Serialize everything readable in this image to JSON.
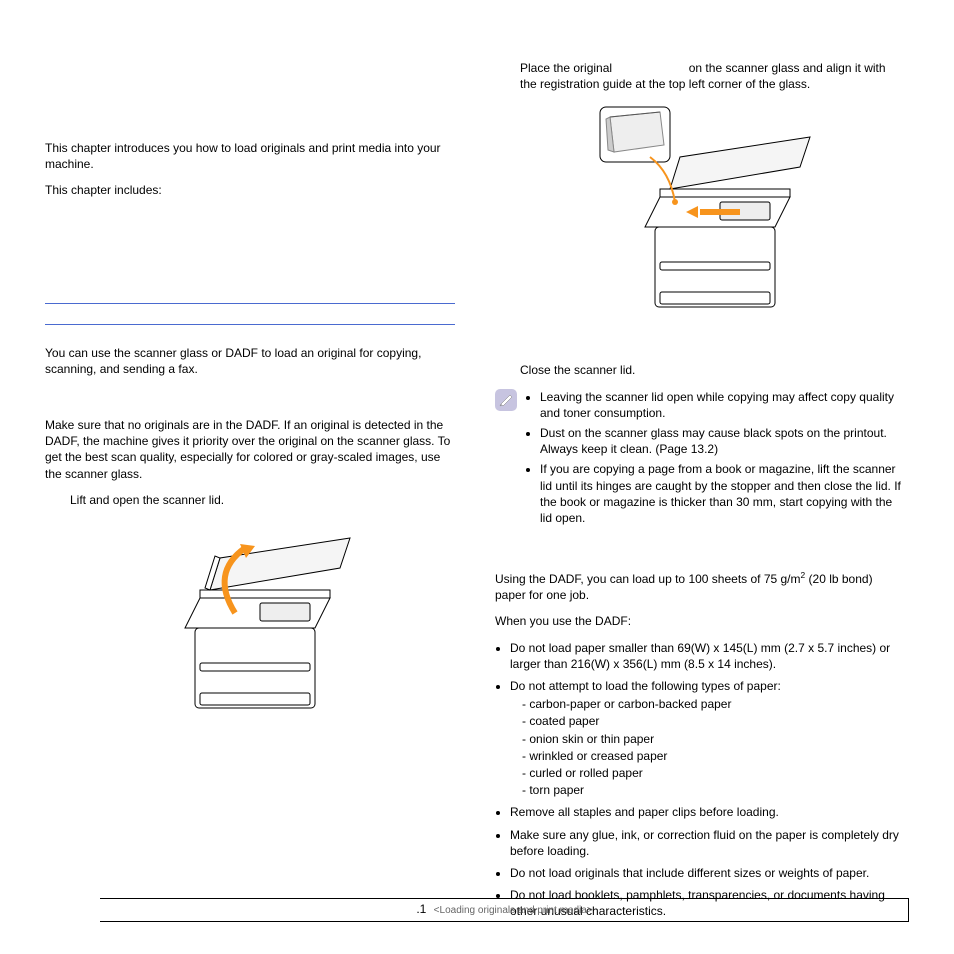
{
  "left": {
    "intro": "This chapter introduces you how to load originals and print media into your machine.",
    "includes": "This chapter includes:",
    "loading_text": "You can use the scanner glass or DADF to load an original for copying, scanning, and sending a fax.",
    "scanner_glass_para": "Make sure that no originals are in the DADF. If an original is detected in the DADF, the machine gives it priority over the original on the scanner glass. To get the best scan quality, especially for colored or gray-scaled images, use the scanner glass.",
    "step_lift": "Lift and open the scanner lid."
  },
  "right": {
    "place_original_pre": "Place the original",
    "place_original_post": "on the scanner glass and align it with the registration guide at the top left corner of the glass.",
    "close_lid": "Close the scanner lid.",
    "notes": [
      "Leaving the scanner lid open while copying may affect copy quality and toner consumption.",
      "Dust on the scanner glass may cause black spots on the printout. Always keep it clean. (Page 13.2)",
      "If you are copying a page from a book or magazine, lift the scanner lid until its hinges are caught by the stopper and then close the lid. If the book or magazine is thicker than 30 mm, start copying with the lid open."
    ],
    "dadf_intro_pre": "Using the DADF, you can load up to 100 sheets of 75 g/m",
    "dadf_intro_sup": "2",
    "dadf_intro_post": " (20 lb bond) paper for one job.",
    "when_use": "When you use the DADF:",
    "bullets": {
      "b1": "Do not load paper smaller than 69(W) x 145(L) mm (2.7 x 5.7 inches) or larger than 216(W) x 356(L) mm (8.5 x 14 inches).",
      "b2_lead": "Do not attempt to load the following types of paper:",
      "b2_sub": [
        "carbon-paper or carbon-backed paper",
        "coated paper",
        "onion skin or thin paper",
        "wrinkled or creased paper",
        "curled or rolled paper",
        "torn paper"
      ],
      "b3": "Remove all staples and paper clips before loading.",
      "b4": "Make sure any glue, ink, or correction fluid on the paper is completely dry before loading.",
      "b5": "Do not load originals that include different sizes or weights of paper.",
      "b6": "Do not load booklets, pamphlets, transparencies, or documents having other unusual characteristics."
    }
  },
  "footer": {
    "page_num": ".1",
    "chapter_label": "<Loading originals and print media>"
  }
}
